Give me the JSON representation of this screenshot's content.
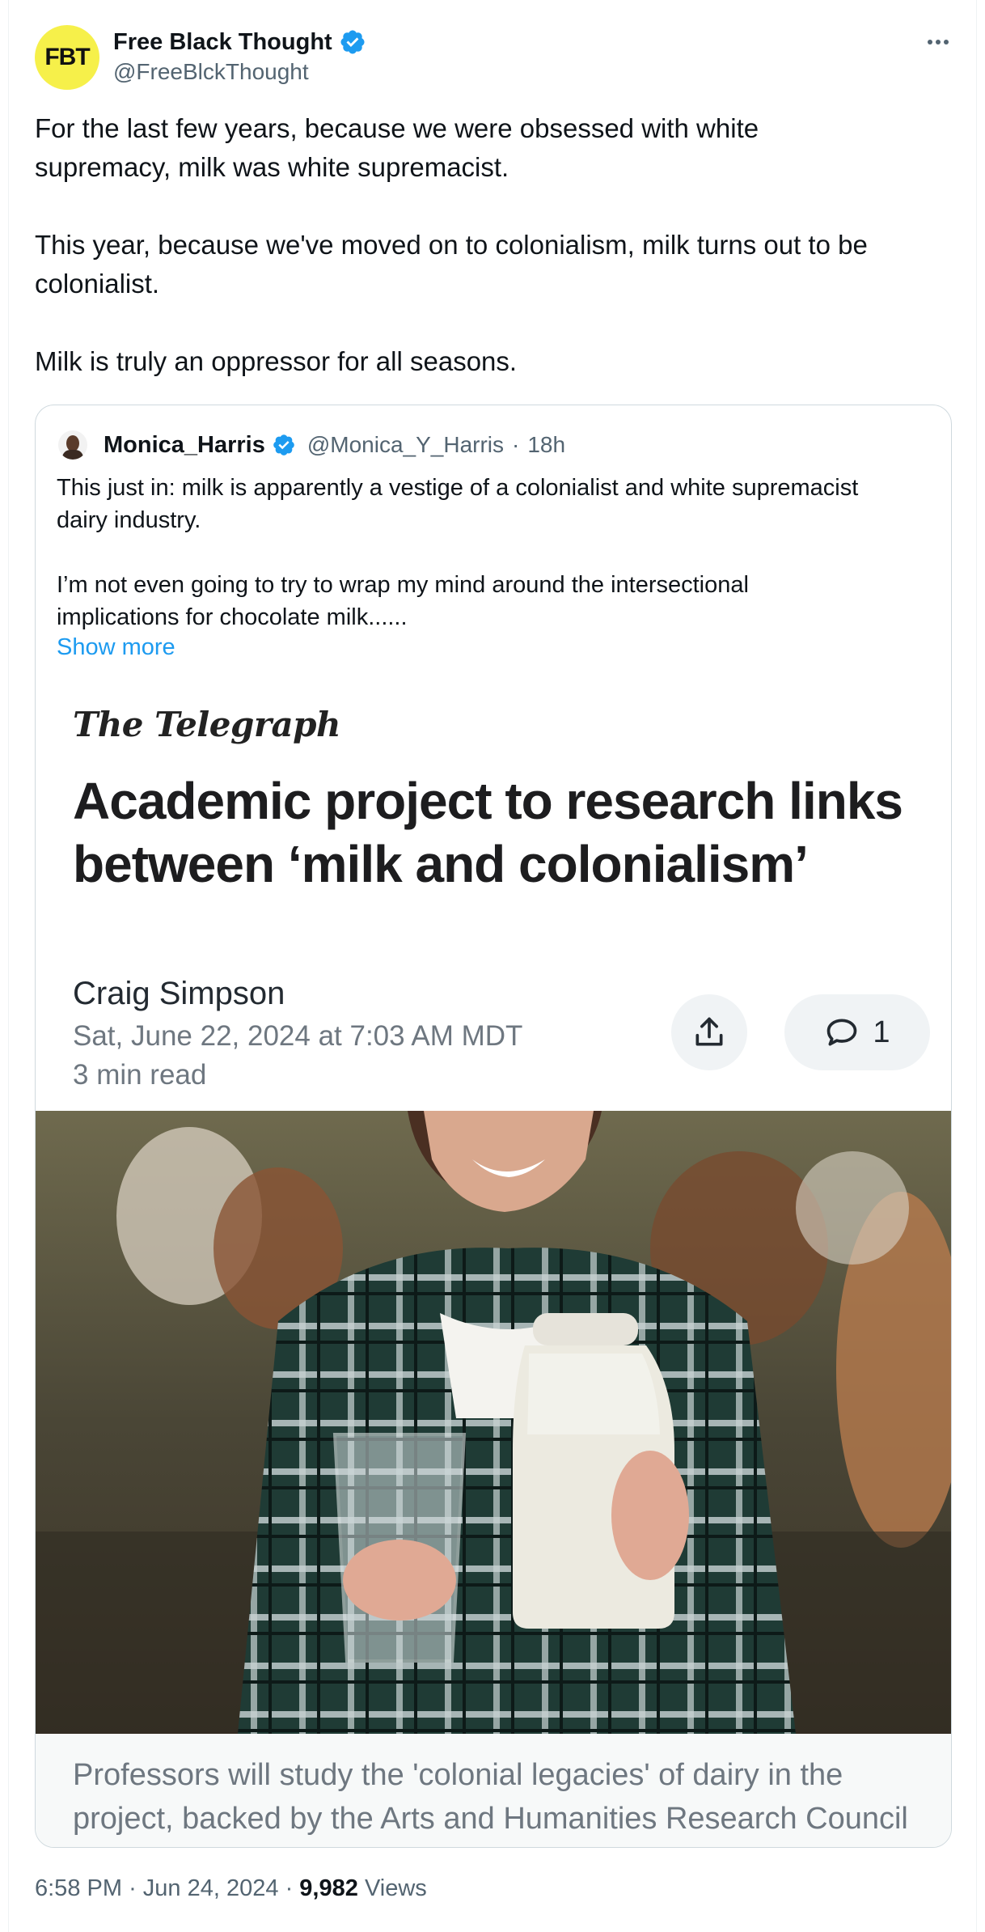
{
  "tweet": {
    "author": {
      "avatar_text": "FBT",
      "name": "Free Black Thought",
      "handle": "@FreeBlckThought",
      "verified": true
    },
    "more_icon": "more-horizontal-icon",
    "text": "For the last few years, because we were obsessed with white\nsupremacy, milk was white supremacist.\n\nThis year, because we've moved on to colonialism, milk turns out to be\ncolonialist.\n\nMilk is truly an oppressor for all seasons.",
    "time": "6:58 PM",
    "date": "Jun 24, 2024",
    "views_count": "9,982",
    "views_label": "Views",
    "separator": "·"
  },
  "quote": {
    "author": {
      "name": "Monica_Harris",
      "handle": "@Monica_Y_Harris",
      "age": "18h",
      "verified": true
    },
    "text": "This just in: milk is apparently a vestige of a colonialist and white supremacist\ndairy industry.\n\nI’m not even going to try to wrap my mind around the intersectional\nimplications for chocolate milk......",
    "show_more": "Show more",
    "article": {
      "publication": "The Telegraph",
      "headline": "Academic project to research links between ‘milk and colonialism’",
      "author": "Craig Simpson",
      "date": "Sat, June 22, 2024 at 7:03 AM MDT",
      "read_time": "3 min read",
      "comment_count": "1",
      "caption": "Professors will study the 'colonial legacies' of dairy in the project, backed by the Arts and Humanities Research Council"
    }
  },
  "colors": {
    "verified_blue": "#1d9bf0",
    "link_blue": "#1d9bf0",
    "avatar_yellow": "#f6f04a",
    "secondary_text": "#536471"
  }
}
